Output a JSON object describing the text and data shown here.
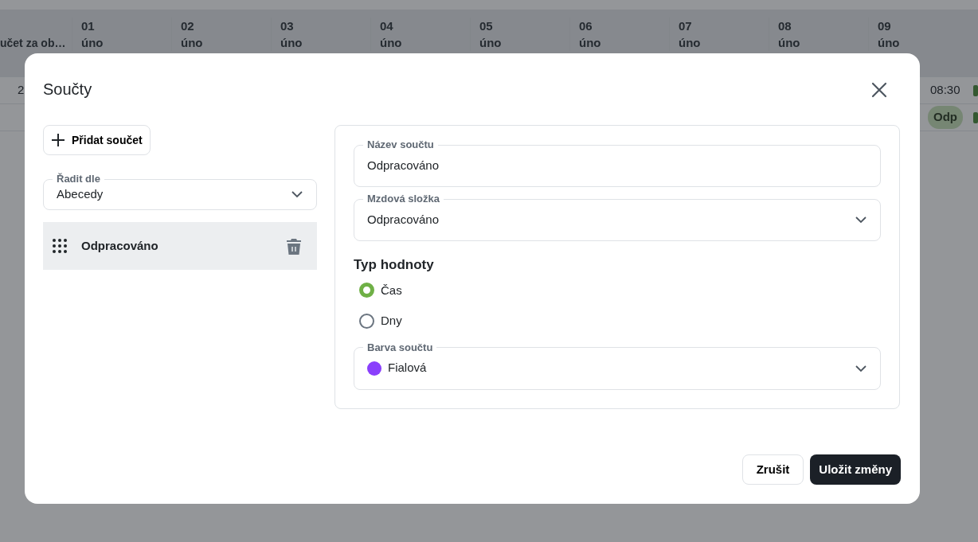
{
  "background_table": {
    "first_header": "učet za ob…",
    "columns": [
      {
        "day": "01",
        "month": "úno"
      },
      {
        "day": "02",
        "month": "úno"
      },
      {
        "day": "03",
        "month": "úno"
      },
      {
        "day": "04",
        "month": "úno"
      },
      {
        "day": "05",
        "month": "úno"
      },
      {
        "day": "06",
        "month": "úno"
      },
      {
        "day": "07",
        "month": "úno"
      },
      {
        "day": "08",
        "month": "úno"
      },
      {
        "day": "09",
        "month": "úno"
      }
    ],
    "rows": [
      {
        "first": "2",
        "time": "08:30"
      },
      {
        "badge": "Odp"
      }
    ]
  },
  "modal": {
    "title": "Součty",
    "add_button": "Přidat součet",
    "sort": {
      "label": "Řadit dle",
      "value": "Abecedy"
    },
    "items": [
      {
        "label": "Odpracováno",
        "selected": true
      }
    ],
    "name_field": {
      "label": "Název součtu",
      "value": "Odpracováno"
    },
    "wage_field": {
      "label": "Mzdová složka",
      "value": "Odpracováno"
    },
    "value_type": {
      "heading": "Typ hodnoty",
      "options": [
        {
          "label": "Čas",
          "selected": true
        },
        {
          "label": "Dny",
          "selected": false
        }
      ]
    },
    "color_field": {
      "label": "Barva součtu",
      "value": "Fialová",
      "color": "#8a3ffc"
    },
    "buttons": [
      {
        "label": "Zrušit",
        "kind": "secondary"
      },
      {
        "label": "Uložit změny",
        "kind": "primary"
      }
    ]
  }
}
